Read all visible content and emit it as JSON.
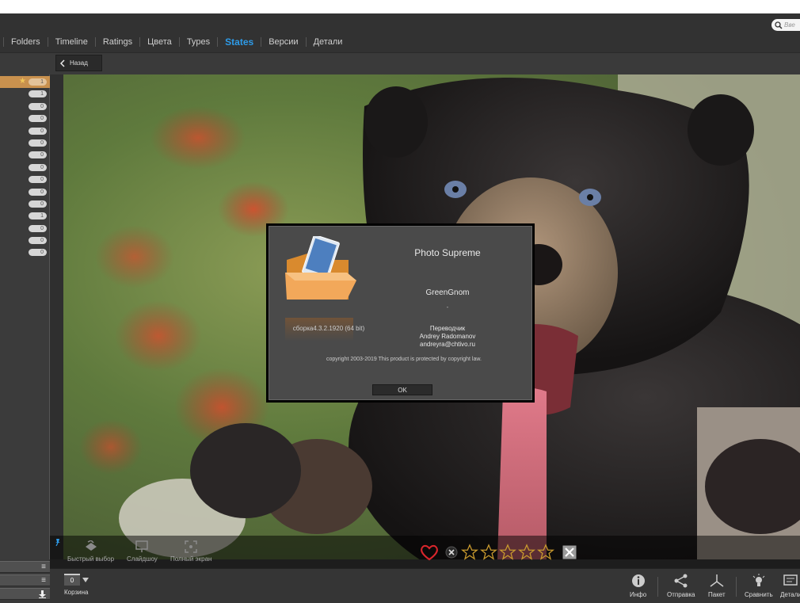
{
  "nav": {
    "tabs": [
      {
        "label": "Folders"
      },
      {
        "label": "Timeline"
      },
      {
        "label": "Ratings"
      },
      {
        "label": "Цвета"
      },
      {
        "label": "Types"
      },
      {
        "label": "States"
      },
      {
        "label": "Версии"
      },
      {
        "label": "Детали"
      }
    ],
    "active_tab": "States",
    "search": {
      "placeholder": "Вве"
    }
  },
  "subbar": {
    "back_label": "Назад"
  },
  "sidebar": {
    "counts": [
      "1",
      "1",
      "0",
      "0",
      "0",
      "0",
      "0",
      "0",
      "0",
      "0",
      "0",
      "1",
      "0",
      "0",
      "0"
    ]
  },
  "viewer_toolbar": {
    "quick_pick": "Быстрый выбор",
    "slideshow": "Слайдшоу",
    "fullscreen": "Полный экран"
  },
  "bottom_bar": {
    "basket_count": "0",
    "basket_label": "Корзина",
    "info": "Инфо",
    "share": "Отправка",
    "batch": "Пакет",
    "compare": "Сравнить",
    "details": "Детали"
  },
  "about_dialog": {
    "title": "Photo Supreme",
    "author": "GreenGnom",
    "dash": "-",
    "build": "сборка4.3.2.1920 (64 bit)",
    "translator_label": "Переводчик",
    "translator_name": "Andrey Radomanov",
    "translator_email": "andreyra@chtivo.ru",
    "copyright": "copyright 2003-2019 This product is protected by copyright law.",
    "ok": "OK"
  },
  "colors": {
    "accent": "#2e9be8",
    "selected_row": "#c9914e",
    "heart": "#d9262c",
    "star_outline": "#c99a2e"
  },
  "rating": {
    "stars": 0,
    "max": 5,
    "liked": false
  }
}
